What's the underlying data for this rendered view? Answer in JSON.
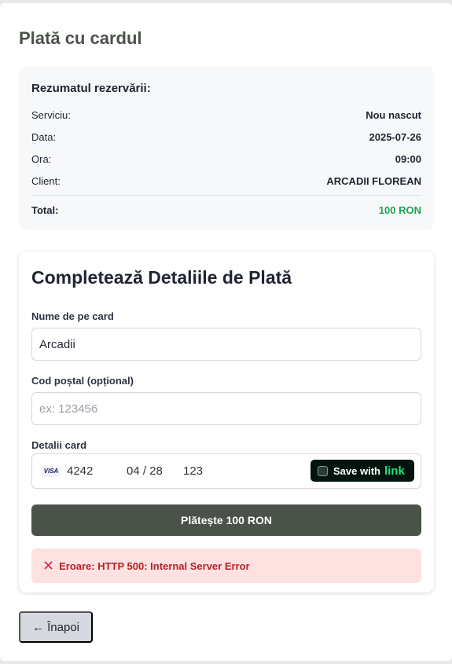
{
  "page_title": "Plată cu cardul",
  "summary": {
    "heading": "Rezumatul rezervării:",
    "rows": [
      {
        "label": "Serviciu:",
        "value": "Nou nascut"
      },
      {
        "label": "Data:",
        "value": "2025-07-26"
      },
      {
        "label": "Ora:",
        "value": "09:00"
      },
      {
        "label": "Client:",
        "value": "ARCADII FLOREAN"
      }
    ],
    "total_label": "Total:",
    "total_value": "100 RON",
    "total_color": "#1aa251"
  },
  "form": {
    "title": "Completează Detaliile de Plată",
    "name_label": "Nume de pe card",
    "name_value": "Arcadii",
    "postal_label": "Cod poștal (opțional)",
    "postal_placeholder": "ex: 123456",
    "card_label": "Detalii card",
    "card_brand": "VISA",
    "card_number": "4242",
    "card_expiry": "04 / 28",
    "card_cvc": "123",
    "link_save_label": "Save with",
    "link_word": "link",
    "pay_button": "Plătește 100 RON",
    "error_icon": "close-x-icon",
    "error_text": "Eroare: HTTP 500: Internal Server Error"
  },
  "back_button": "← Înapoi",
  "colors": {
    "accent": "#4a5249",
    "error_bg": "#fee2e2",
    "error_text": "#b22323"
  }
}
